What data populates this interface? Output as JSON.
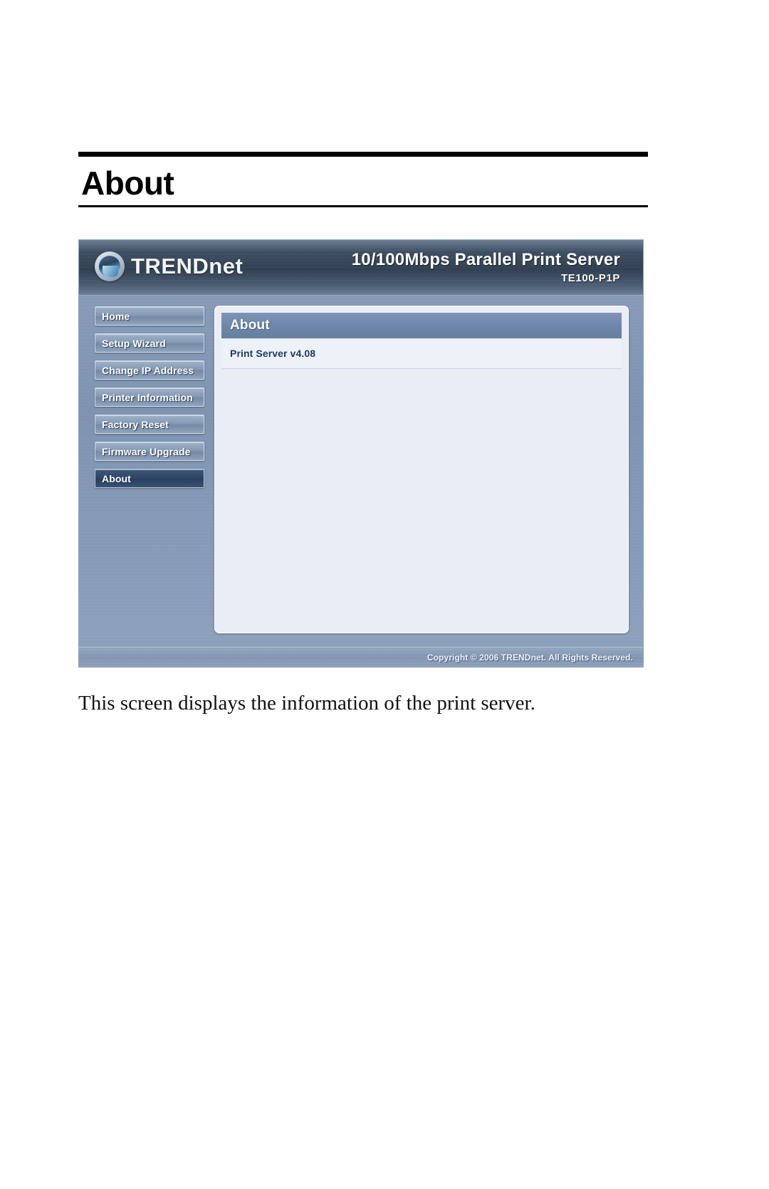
{
  "document": {
    "section_title": "About",
    "caption": "This screen displays the information of the print server."
  },
  "screenshot": {
    "header": {
      "brand_name": "TRENDnet",
      "brand_icon": "trendnet-globe-icon",
      "product_name": "10/100Mbps Parallel Print Server",
      "product_model": "TE100-P1P"
    },
    "nav": {
      "items": [
        {
          "label": "Home",
          "active": false
        },
        {
          "label": "Setup Wizard",
          "active": false
        },
        {
          "label": "Change IP Address",
          "active": false
        },
        {
          "label": "Printer Information",
          "active": false
        },
        {
          "label": "Factory Reset",
          "active": false
        },
        {
          "label": "Firmware Upgrade",
          "active": false
        },
        {
          "label": "About",
          "active": true
        }
      ]
    },
    "panel": {
      "title": "About",
      "rows": [
        {
          "text": "Print Server v4.08"
        }
      ]
    },
    "footer": {
      "copyright": "Copyright © 2006 TRENDnet. All Rights Reserved."
    },
    "colors": {
      "header_dark": "#2f3e52",
      "chrome_blue": "#8ba0bd",
      "panel_title": "#6e87aa",
      "panel_bg": "#e9edf6",
      "link_navy": "#1b3a6b",
      "nav_active": "#2f4766"
    }
  }
}
